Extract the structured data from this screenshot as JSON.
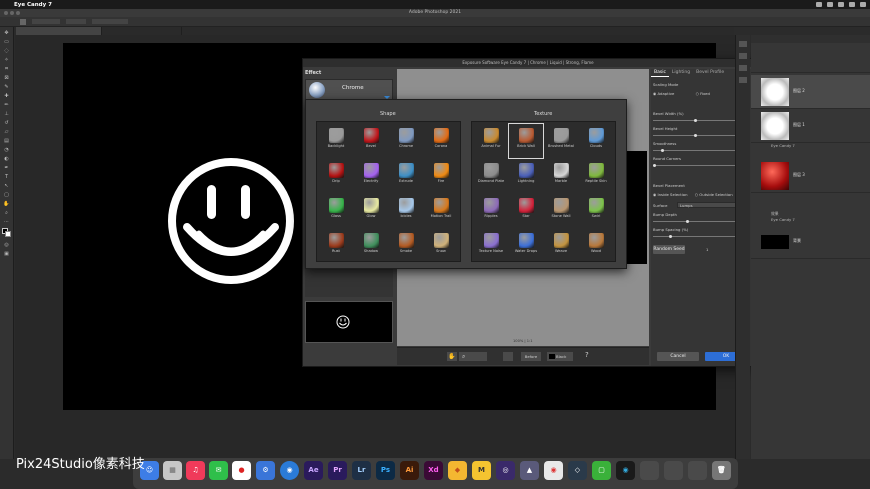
{
  "menubar": {
    "app_name": "Eye Candy 7"
  },
  "window": {
    "title": "Adobe Photoshop 2021"
  },
  "dialog": {
    "title": "Exposure Software Eye Candy 7 | Chrome | Liquid | Strong, Flame",
    "effect_label": "Effect",
    "effect_name": "Chrome",
    "tabs": [
      "Basic",
      "Lighting",
      "Bevel Profile"
    ],
    "scaling_mode_label": "Scaling Mode",
    "scaling_options": [
      "Adaptive",
      "Fixed"
    ],
    "params": [
      {
        "label": "Bevel Width (%)",
        "value": "50.00",
        "fraction": 0.5
      },
      {
        "label": "Bevel Height",
        "value": "50",
        "fraction": 0.5
      },
      {
        "label": "Smoothness",
        "value": "10.00",
        "fraction": 0.1
      },
      {
        "label": "Round Corners",
        "value": "0",
        "fraction": 0.0
      }
    ],
    "bevel_placement_label": "Bevel Placement",
    "bevel_placement_options": [
      "Inside Selection",
      "Outside Selection"
    ],
    "surface_label": "Surface",
    "surface_value": "Lumps",
    "bump_params": [
      {
        "label": "Bump Depth",
        "value": "40",
        "fraction": 0.4
      },
      {
        "label": "Bump Spacing (%)",
        "value": "20.00",
        "fraction": 0.2
      }
    ],
    "random_seed_label": "Random Seed",
    "random_seed_value": "1",
    "cancel_label": "Cancel",
    "ok_label": "OK",
    "bottom_bar": {
      "before_label": "Before",
      "black_label": "Black"
    },
    "zoom_readout": "100% | 1:1"
  },
  "presets": {
    "shape_heading": "Shape",
    "texture_heading": "Texture",
    "shape_items": [
      {
        "label": "Backlight",
        "color": "#9a9a9a"
      },
      {
        "label": "Bevel",
        "color": "#c0151a"
      },
      {
        "label": "Chrome",
        "color": "#7f99c0"
      },
      {
        "label": "Corona",
        "color": "#e26b14"
      },
      {
        "label": "Drip",
        "color": "#b51212"
      },
      {
        "label": "Electrify",
        "color": "#a461f0"
      },
      {
        "label": "Extrude",
        "color": "#3d8fc6"
      },
      {
        "label": "Fire",
        "color": "#f08a12"
      },
      {
        "label": "Glass",
        "color": "#37b34a"
      },
      {
        "label": "Glow",
        "color": "#e7e9a1"
      },
      {
        "label": "Icicles",
        "color": "#a6c8ea"
      },
      {
        "label": "Motion Trail",
        "color": "#d9781a"
      },
      {
        "label": "Rust",
        "color": "#9c3b1c"
      },
      {
        "label": "Shadow",
        "color": "#3f8f5c"
      },
      {
        "label": "Smoke",
        "color": "#b35a22"
      },
      {
        "label": "Snow",
        "color": "#d0b27a"
      }
    ],
    "texture_items": [
      {
        "label": "Animal Fur",
        "color": "#c98a2f"
      },
      {
        "label": "Brick Wall",
        "color": "#b85a32"
      },
      {
        "label": "Brushed Metal",
        "color": "#9a9a9a"
      },
      {
        "label": "Clouds",
        "color": "#5f9ad6"
      },
      {
        "label": "Diamond Plate",
        "color": "#8c8c8c"
      },
      {
        "label": "Lightning",
        "color": "#4a5fb8"
      },
      {
        "label": "Marble",
        "color": "#d6d6d6"
      },
      {
        "label": "Reptile Skin",
        "color": "#7fb83d"
      },
      {
        "label": "Ripples",
        "color": "#8d6ab8"
      },
      {
        "label": "Star",
        "color": "#d3223a"
      },
      {
        "label": "Stone Wall",
        "color": "#b89670"
      },
      {
        "label": "Swirl",
        "color": "#7cc24a"
      },
      {
        "label": "Texture Noise",
        "color": "#8a6fd0"
      },
      {
        "label": "Water Drops",
        "color": "#3c6fd8"
      },
      {
        "label": "Weave",
        "color": "#c4943f"
      },
      {
        "label": "Wood",
        "color": "#b8783a"
      }
    ]
  },
  "layers": {
    "items": [
      {
        "name": "图层 2",
        "kind": "smiley"
      },
      {
        "name": "图层 1",
        "kind": "smiley-outline"
      },
      {
        "name": "图层 3",
        "kind": "red"
      },
      {
        "name": "背景",
        "kind": "black"
      }
    ],
    "effects": [
      "Eye Candy 7",
      "效果",
      "Eye Candy 7"
    ]
  },
  "watermark": "Pix24Studio像素科技"
}
